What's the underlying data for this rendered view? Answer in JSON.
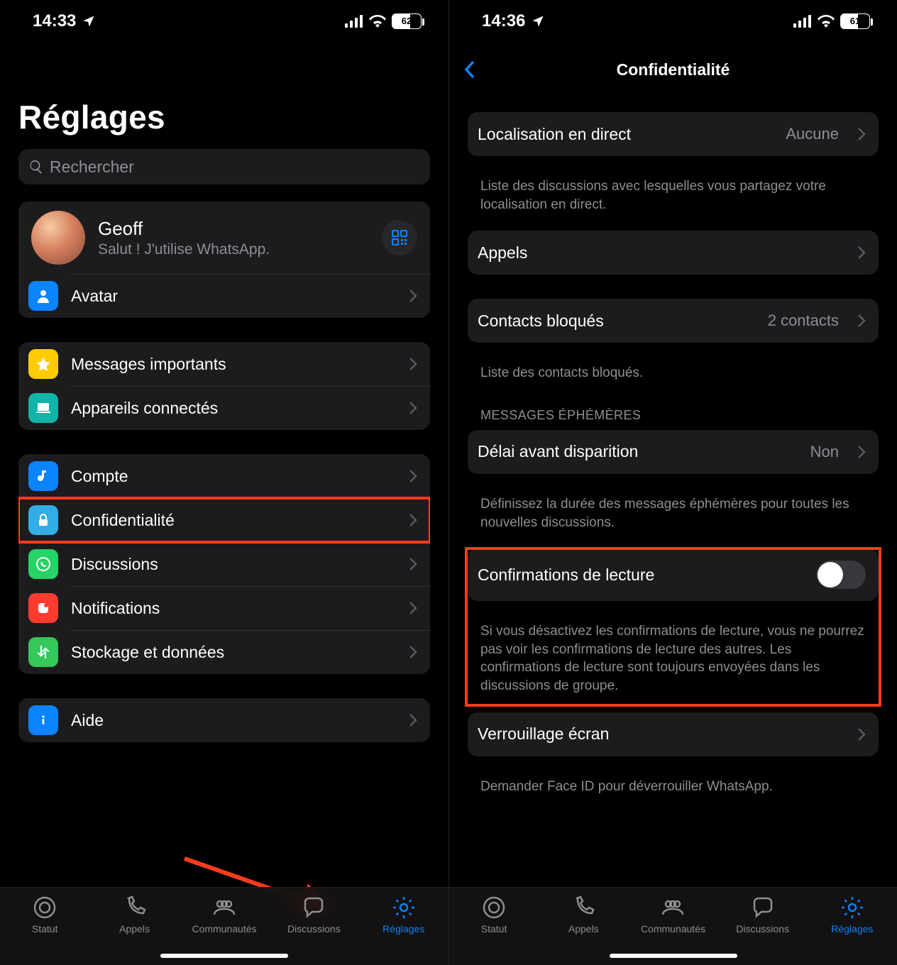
{
  "left": {
    "status": {
      "time": "14:33",
      "battery": "62"
    },
    "title": "Réglages",
    "search_placeholder": "Rechercher",
    "profile": {
      "name": "Geoff",
      "status": "Salut ! J'utilise WhatsApp."
    },
    "rows": {
      "avatar": "Avatar",
      "starred": "Messages importants",
      "linked": "Appareils connectés",
      "account": "Compte",
      "privacy": "Confidentialité",
      "chats": "Discussions",
      "notifications": "Notifications",
      "storage": "Stockage et données",
      "help": "Aide"
    },
    "tabs": {
      "status": "Statut",
      "calls": "Appels",
      "communities": "Communautés",
      "chats": "Discussions",
      "settings": "Réglages"
    }
  },
  "right": {
    "status": {
      "time": "14:36",
      "battery": "61"
    },
    "nav_title": "Confidentialité",
    "rows": {
      "live_location": {
        "label": "Localisation en direct",
        "value": "Aucune"
      },
      "calls": {
        "label": "Appels"
      },
      "blocked": {
        "label": "Contacts bloqués",
        "value": "2 contacts"
      },
      "disappearing": {
        "label": "Délai avant disparition",
        "value": "Non"
      },
      "read_receipts": {
        "label": "Confirmations de lecture"
      },
      "screen_lock": {
        "label": "Verrouillage écran"
      }
    },
    "captions": {
      "live_location": "Liste des discussions avec lesquelles vous partagez votre localisation en direct.",
      "blocked": "Liste des contacts bloqués.",
      "disappearing_header": "MESSAGES ÉPHÉMÈRES",
      "disappearing": "Définissez la durée des messages éphémères pour toutes les nouvelles discussions.",
      "read_receipts": "Si vous désactivez les confirmations de lecture, vous ne pourrez pas voir les confirmations de lecture des autres. Les confirmations de lecture sont toujours envoyées dans les discussions de groupe.",
      "screen_lock": "Demander Face ID pour déverrouiller WhatsApp."
    },
    "tabs": {
      "status": "Statut",
      "calls": "Appels",
      "communities": "Communautés",
      "chats": "Discussions",
      "settings": "Réglages"
    }
  }
}
